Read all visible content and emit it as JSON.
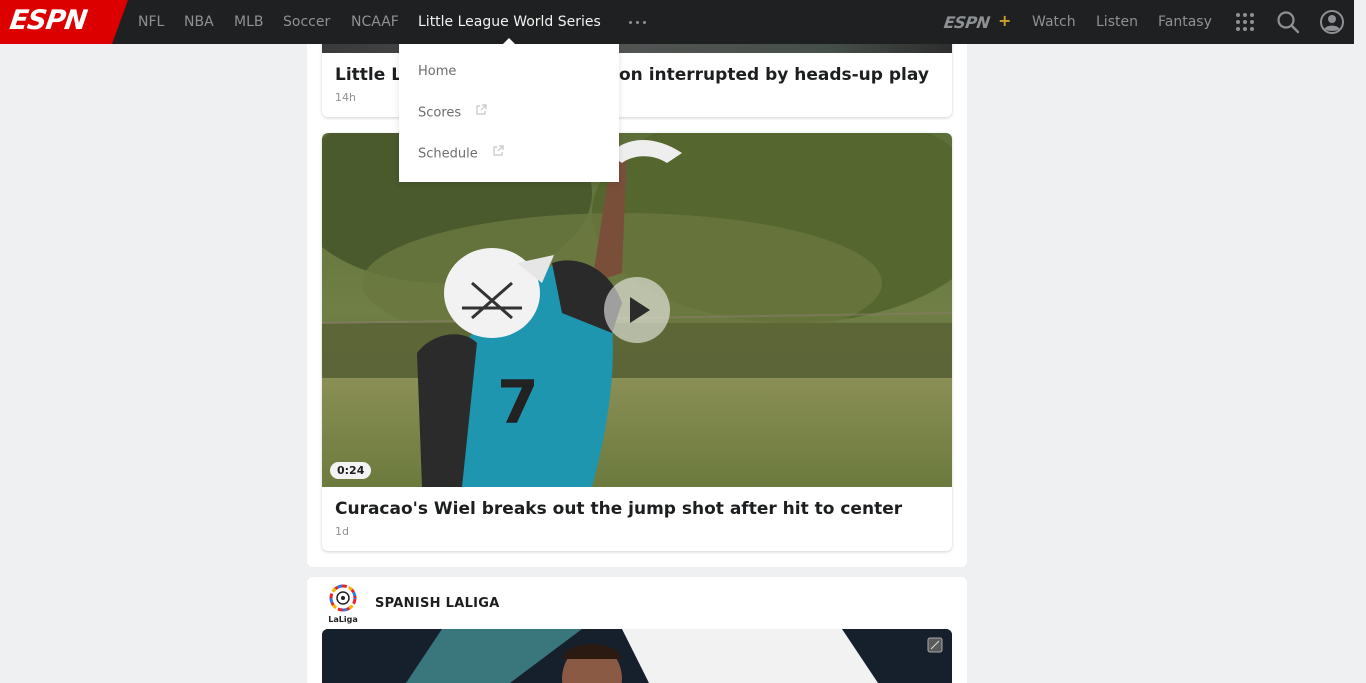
{
  "brand": {
    "logo_text": "ESPN",
    "logo_color": "#d00"
  },
  "nav": {
    "links": [
      "NFL",
      "NBA",
      "MLB",
      "Soccer",
      "NCAAF",
      "Little League World Series"
    ],
    "active": "Little League World Series",
    "right_links": [
      "Watch",
      "Listen",
      "Fantasy"
    ],
    "espnplus_text": "ESPN",
    "espnplus_plus": "+"
  },
  "dropdown": {
    "items": [
      {
        "label": "Home",
        "external": false
      },
      {
        "label": "Scores",
        "external": true
      },
      {
        "label": "Schedule",
        "external": true
      }
    ]
  },
  "stories": [
    {
      "headline_left": "Little L",
      "headline_right": "on interrupted by heads-up play",
      "time": "14h"
    },
    {
      "headline": "Curacao's Wiel breaks out the jump shot after hit to center",
      "time": "1d",
      "duration": "0:24",
      "media": "video"
    }
  ],
  "section": {
    "title": "SPANISH LALIGA",
    "logo_caption": "LaLiga"
  }
}
